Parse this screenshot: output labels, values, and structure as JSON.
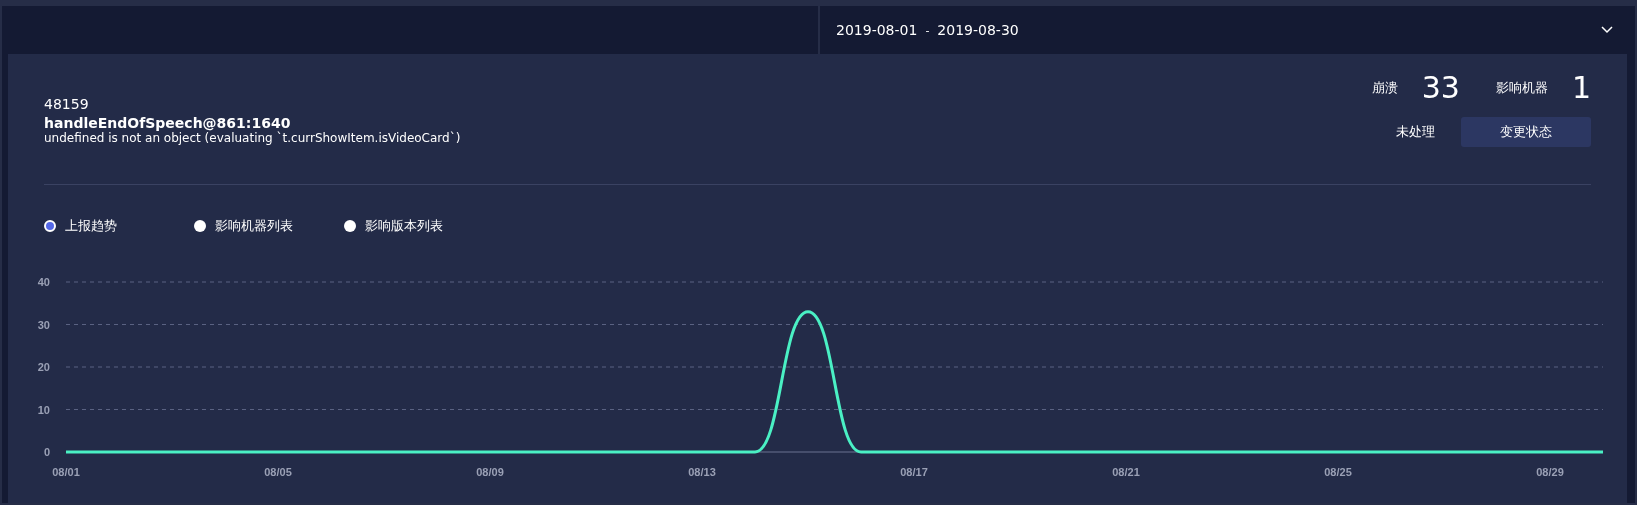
{
  "date_range": {
    "start": "2019-08-01",
    "separator": "-",
    "end": "2019-08-30"
  },
  "issue": {
    "id": "48159",
    "function": "handleEndOfSpeech@861:1640",
    "message": "undefined is not an object (evaluating `t.currShowItem.isVideoCard`)"
  },
  "stats": [
    {
      "label": "崩溃",
      "value": "33"
    },
    {
      "label": "影响机器",
      "value": "1"
    }
  ],
  "status": "未处理",
  "change_button": "变更状态",
  "views": [
    {
      "label": "上报趋势",
      "selected": true
    },
    {
      "label": "影响机器列表",
      "selected": false
    },
    {
      "label": "影响版本列表",
      "selected": false
    }
  ],
  "chart_data": {
    "type": "line",
    "grid": true,
    "categories": [
      "08/01",
      null,
      null,
      null,
      "08/05",
      null,
      null,
      null,
      "08/09",
      null,
      null,
      null,
      "08/13",
      null,
      null,
      null,
      "08/17",
      null,
      null,
      null,
      "08/21",
      null,
      null,
      null,
      "08/25",
      null,
      null,
      null,
      "08/29",
      null
    ],
    "series": [
      {
        "color": "#4af0c4",
        "values": [
          0,
          0,
          0,
          0,
          0,
          0,
          0,
          0,
          0,
          0,
          0,
          0,
          0,
          0,
          33,
          0,
          0,
          0,
          0,
          0,
          0,
          0,
          0,
          0,
          0,
          0,
          0,
          0,
          0,
          0
        ]
      }
    ],
    "ylim": [
      0,
      40
    ],
    "yticks": [
      0,
      10,
      20,
      30,
      40
    ]
  }
}
